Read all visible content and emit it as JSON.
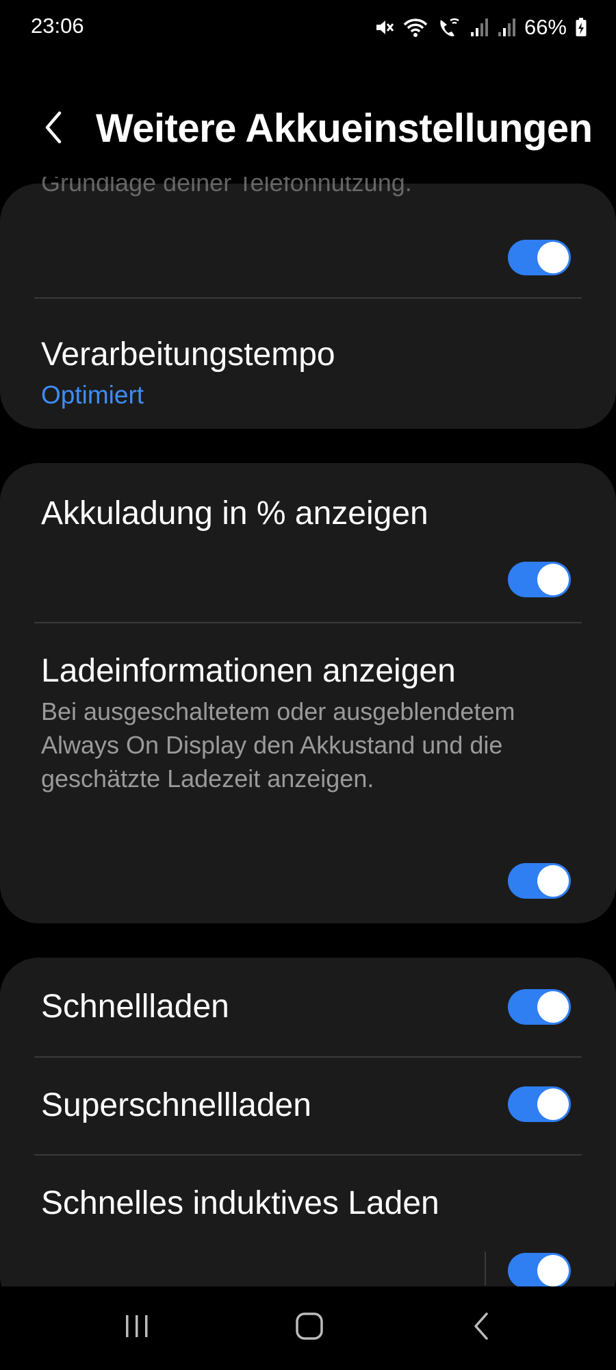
{
  "status_bar": {
    "time": "23:06",
    "battery_percent": "66%",
    "icons": [
      "mute-icon",
      "wifi-icon",
      "wifi-call-icon",
      "signal-icon",
      "signal-icon",
      "battery-charging-icon"
    ]
  },
  "header": {
    "back_icon": "chevron-left-icon",
    "title": "Weitere Akkueinstellungen"
  },
  "cards": {
    "adaptive": {
      "faded_text": "Grundlage deiner Telefonnutzung.",
      "toggle_on": true
    },
    "processing": {
      "title": "Verarbeitungstempo",
      "value": "Optimiert"
    },
    "percent": {
      "title": "Akkuladung in % anzeigen",
      "toggle_on": true
    },
    "charging_info": {
      "title": "Ladeinformationen anzeigen",
      "description": "Bei ausgeschaltetem oder ausgeblendetem Always On Display den Akkustand und die geschätzte Ladezeit anzeigen.",
      "toggle_on": true
    },
    "fast_charging": {
      "title": "Schnellladen",
      "toggle_on": true
    },
    "super_fast_charging": {
      "title": "Superschnellladen",
      "toggle_on": true
    },
    "fast_wireless": {
      "title": "Schnelles induktives Laden",
      "toggle_on": true
    }
  },
  "nav_bar": {
    "buttons": [
      "recent-apps-icon",
      "home-icon",
      "back-icon"
    ]
  },
  "colors": {
    "background": "#000000",
    "card": "#1b1b1b",
    "accent": "#2f7ef2",
    "link": "#3d8df5",
    "secondary_text": "#9a9a9a"
  }
}
